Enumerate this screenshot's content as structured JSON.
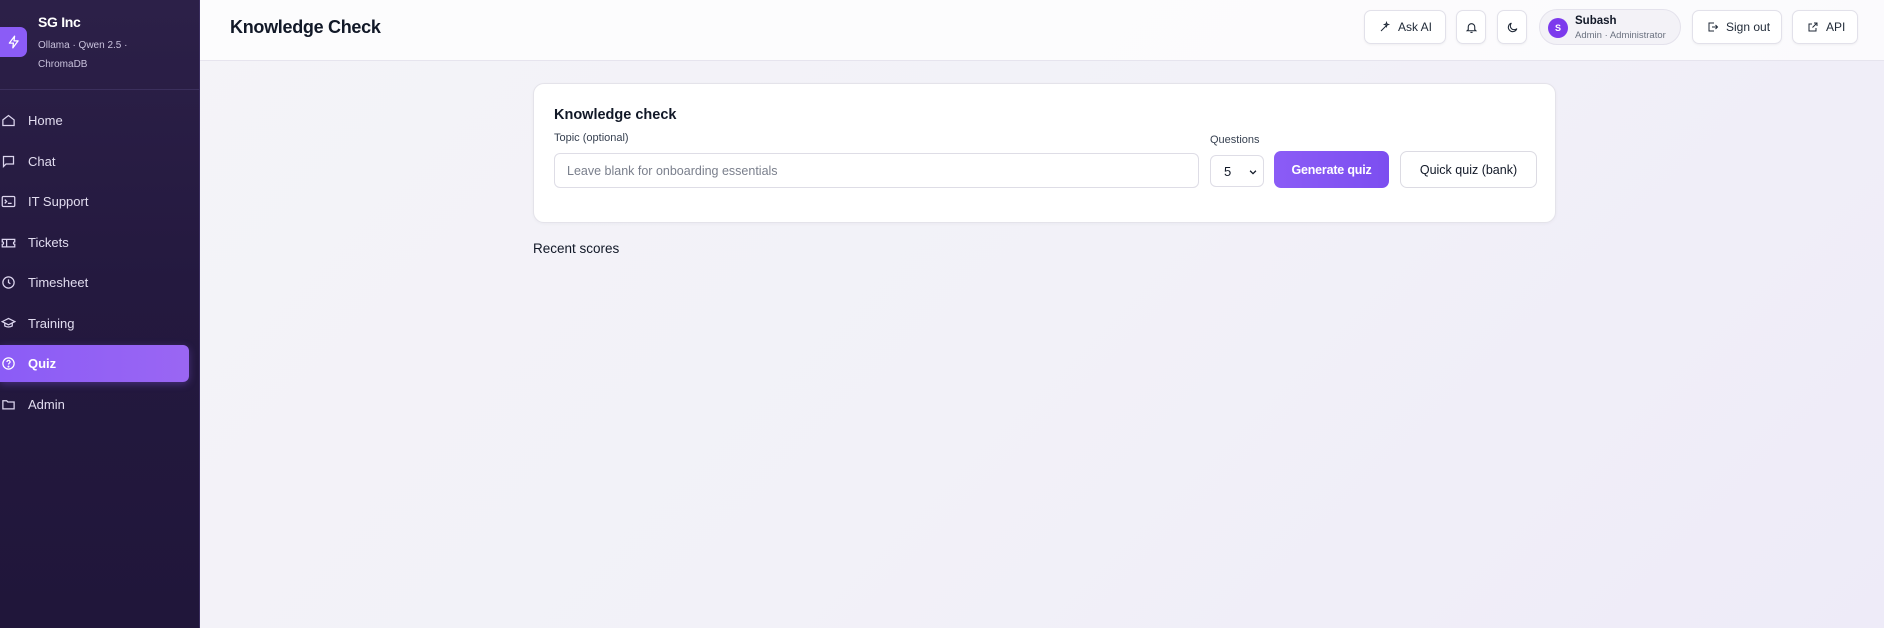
{
  "brand": {
    "name": "SG Inc",
    "subtitle": "Ollama · Qwen 2.5 · ChromaDB"
  },
  "sidebar": {
    "items": [
      {
        "label": "Home",
        "icon": "home-icon"
      },
      {
        "label": "Chat",
        "icon": "chat-icon"
      },
      {
        "label": "IT Support",
        "icon": "terminal-icon"
      },
      {
        "label": "Tickets",
        "icon": "ticket-icon"
      },
      {
        "label": "Timesheet",
        "icon": "clock-icon"
      },
      {
        "label": "Training",
        "icon": "graduation-cap-icon"
      },
      {
        "label": "Quiz",
        "icon": "help-circle-icon",
        "active": true
      },
      {
        "label": "Admin",
        "icon": "folder-icon"
      }
    ]
  },
  "header": {
    "title": "Knowledge Check",
    "ask_ai_label": "Ask AI",
    "user": {
      "initial": "S",
      "name": "Subash",
      "role": "Admin · Administrator"
    },
    "sign_out_label": "Sign out",
    "api_label": "API"
  },
  "quiz_card": {
    "title": "Knowledge check",
    "topic_label": "Topic (optional)",
    "topic_placeholder": "Leave blank for onboarding essentials",
    "topic_value": "",
    "questions_label": "Questions",
    "questions_value": "5",
    "generate_label": "Generate quiz",
    "quick_label": "Quick quiz (bank)"
  },
  "recent_scores": {
    "title": "Recent scores"
  },
  "colors": {
    "accent": "#8b5cf6",
    "sidebar_bg": "#24193f"
  }
}
